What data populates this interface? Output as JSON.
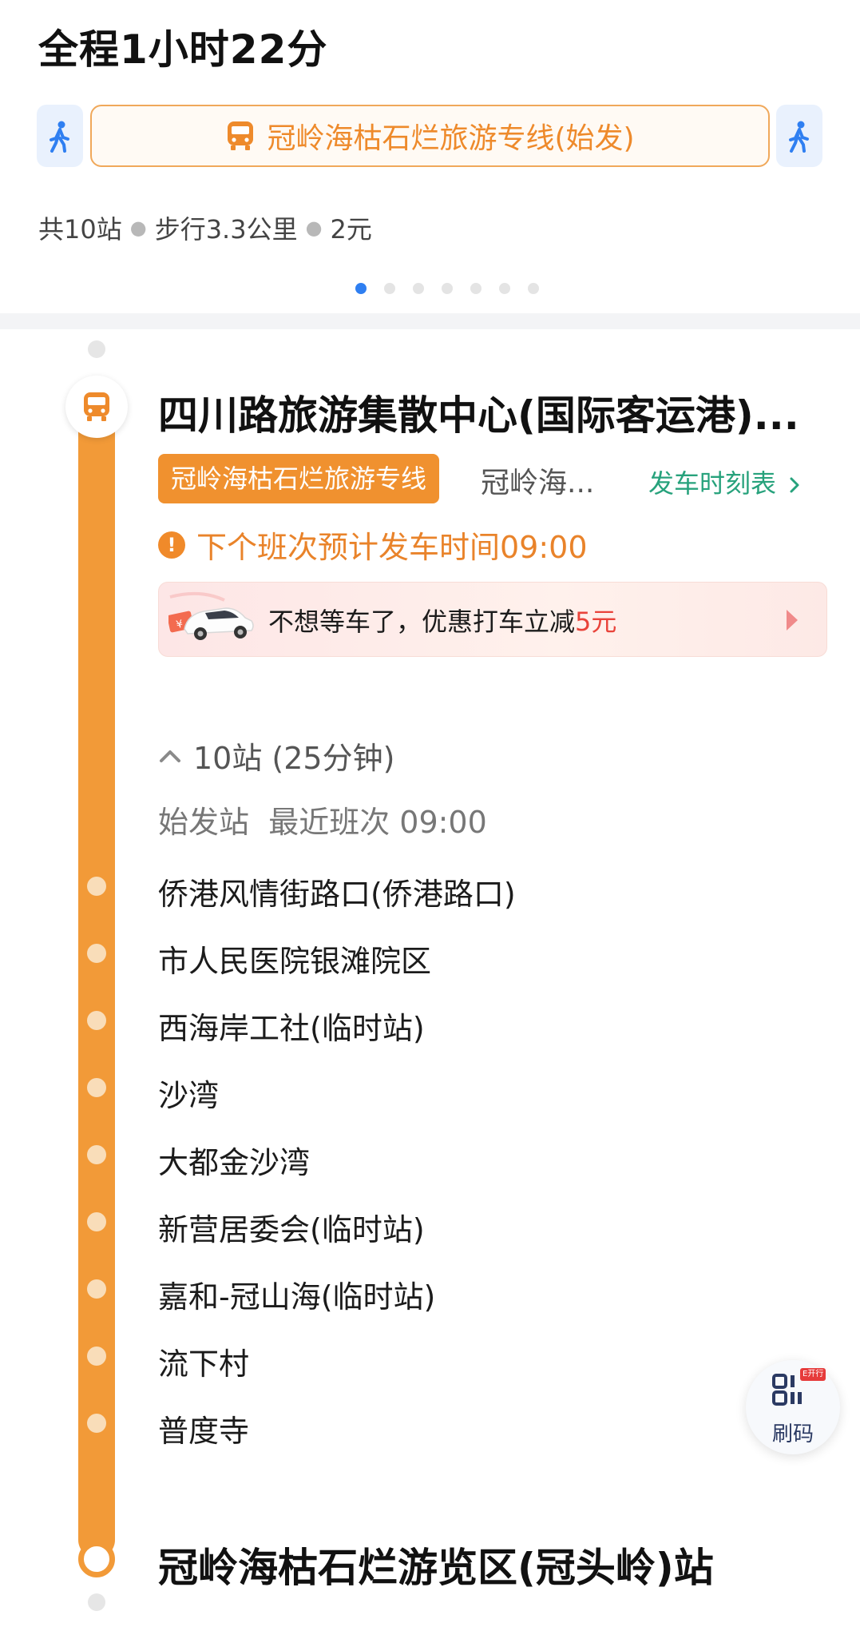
{
  "summary": {
    "total_time": "全程1小时22分",
    "route_name": "冠岭海枯石烂旅游专线(始发)",
    "stats": {
      "stations": "共10站",
      "walk": "步行3.3公里",
      "fare": "2元"
    },
    "pagination": {
      "pages": 7,
      "active_index": 0
    }
  },
  "icons": {
    "walk_left": "walk-icon",
    "bus": "bus-icon",
    "walk_right": "walk-icon"
  },
  "colors": {
    "accent_orange": "#f29a38",
    "primary_blue": "#2f7ff1",
    "timetable_green": "#27a27c",
    "promo_red": "#e9433a"
  },
  "start": {
    "station": "四川路旅游集散中心(国际客运港)...",
    "line_badge": "冠岭海枯石烂旅游专线",
    "direction": "冠岭海...",
    "timetable_link": "发车时刻表",
    "next_departure": "下个班次预计发车时间09:00",
    "taxi_promo": {
      "text": "不想等车了，优惠打车立减",
      "amount": "5元"
    }
  },
  "ride": {
    "summary": "10站 (25分钟)",
    "first_bus_label": "始发站",
    "latest_bus": "最近班次 09:00",
    "stops": [
      "侨港风情街路口(侨港路口)",
      "市人民医院银滩院区",
      "西海岸工社(临时站)",
      "沙湾",
      "大都金沙湾",
      "新营居委会(临时站)",
      "嘉和-冠山海(临时站)",
      "流下村",
      "普度寺"
    ]
  },
  "end": {
    "station": "冠岭海枯石烂游览区(冠头岭)站"
  },
  "scan": {
    "label": "刷码",
    "tag": "E开行"
  }
}
